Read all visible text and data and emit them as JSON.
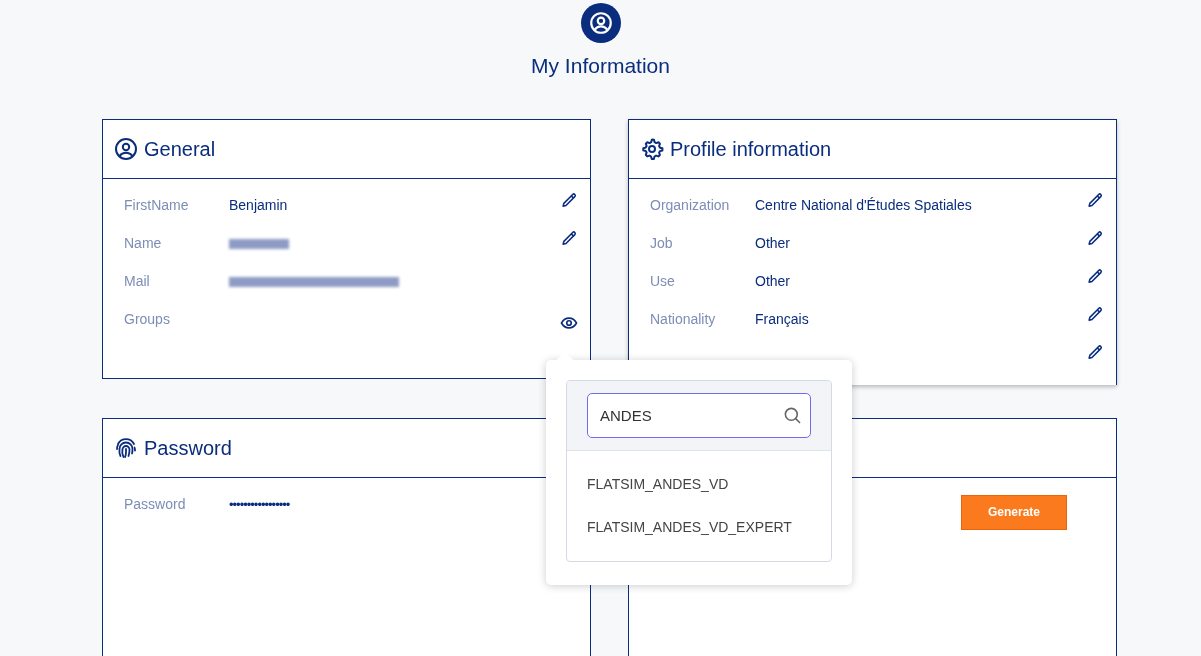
{
  "page": {
    "title": "My Information"
  },
  "cards": [
    {
      "kind": "fields",
      "title": "General",
      "fields": [
        {
          "label": "FirstName",
          "kind": "text",
          "value": "Benjamin",
          "editable": true,
          "viewable": false
        },
        {
          "label": "Name",
          "kind": "redacted",
          "editable": true,
          "viewable": false
        },
        {
          "label": "Mail",
          "kind": "redacted",
          "editable": false,
          "viewable": false
        },
        {
          "label": "Groups",
          "kind": "text",
          "editable": false,
          "viewable": true
        }
      ]
    },
    {
      "kind": "fields",
      "title": "Profile information",
      "fields": [
        {
          "label": "Organization",
          "kind": "text",
          "value": "Centre National d'Études Spatiales",
          "editable": true,
          "viewable": false
        },
        {
          "label": "Job",
          "kind": "text",
          "value": "Other",
          "editable": true,
          "viewable": false
        },
        {
          "label": "Use",
          "kind": "text",
          "value": "Other",
          "editable": true,
          "viewable": false
        },
        {
          "label": "Nationality",
          "kind": "text",
          "value": "Français",
          "editable": true,
          "viewable": false
        },
        {
          "kind": "hidden",
          "editable": true,
          "viewable": false
        }
      ]
    },
    {
      "kind": "fields",
      "title": "Password",
      "fields": [
        {
          "label": "Password",
          "kind": "secret",
          "value": "•••••••••••••••••",
          "editable": false,
          "viewable": false
        }
      ]
    },
    {
      "kind": "button",
      "button": "Generate"
    }
  ],
  "popover": {
    "search": {
      "value": "ANDES"
    },
    "options": [
      "FLATSIM_ANDES_VD",
      "FLATSIM_ANDES_VD_EXPERT"
    ]
  }
}
